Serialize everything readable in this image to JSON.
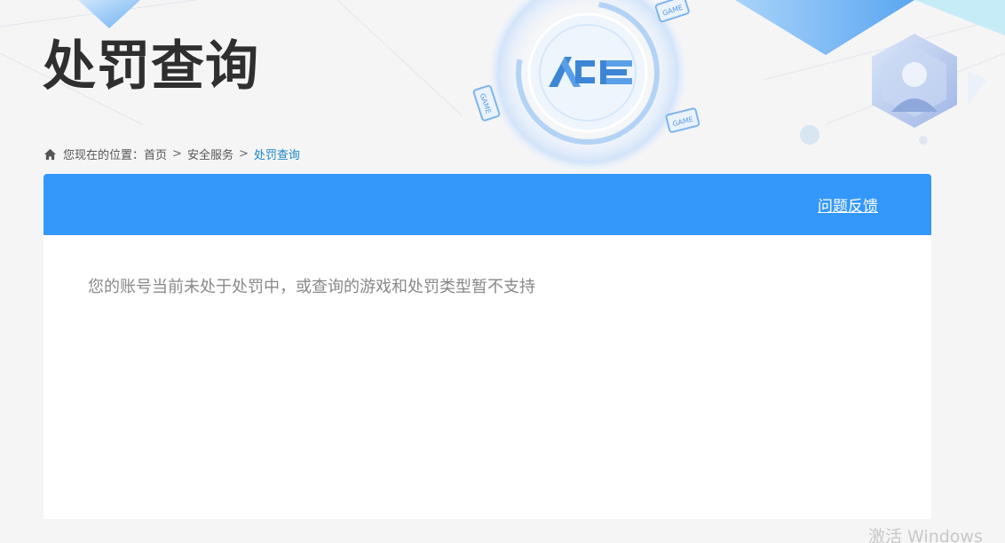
{
  "page": {
    "title": "处罚查询",
    "watermark": "激活 Windows"
  },
  "breadcrumb": {
    "prefix": "您现在的位置：",
    "items": [
      "首页",
      "安全服务"
    ],
    "separator": ">",
    "current": "处罚查询"
  },
  "header_bar": {
    "feedback_label": "问题反馈",
    "color": "#3498fb"
  },
  "content": {
    "message": "您的账号当前未处于处罚中，或查询的游戏和处罚类型暂不支持"
  },
  "logo": {
    "name": "ace-logo",
    "badge_text": "GAME"
  }
}
